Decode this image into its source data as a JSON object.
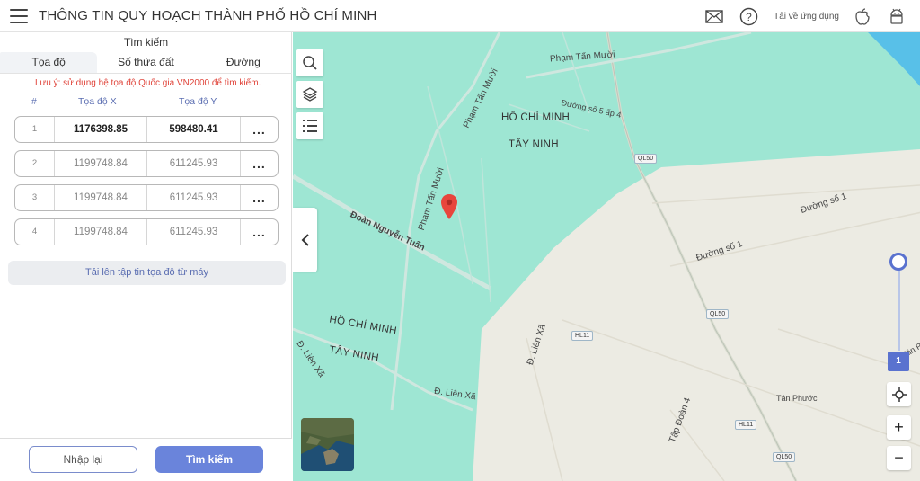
{
  "header": {
    "title": "THÔNG TIN QUY HOẠCH THÀNH PHỐ HỒ CHÍ MINH",
    "download_label": "Tải về ứng dụng",
    "icons": [
      "menu-icon",
      "mail-icon",
      "help-icon",
      "apple-icon",
      "android-icon"
    ]
  },
  "panel": {
    "title": "Tìm kiếm",
    "tabs": [
      {
        "label": "Tọa độ",
        "active": true
      },
      {
        "label": "Số thửa đất",
        "active": false
      },
      {
        "label": "Đường",
        "active": false
      }
    ],
    "note": "Lưu ý: sử dụng hệ tọa độ Quốc gia VN2000 để tìm kiếm.",
    "columns": {
      "num": "#",
      "x": "Tọa độ X",
      "y": "Tọa độ Y"
    },
    "rows": [
      {
        "num": "1",
        "x": "1176398.85",
        "y": "598480.41",
        "more": "..."
      },
      {
        "num": "2",
        "x": "1199748.84",
        "y": "611245.93",
        "more": "..."
      },
      {
        "num": "3",
        "x": "1199748.84",
        "y": "611245.93",
        "more": "..."
      },
      {
        "num": "4",
        "x": "1199748.84",
        "y": "611245.93",
        "more": "..."
      }
    ],
    "upload_label": "Tải lên tập tin tọa độ từ máy",
    "reset_label": "Nhập lại",
    "search_label": "Tìm kiếm"
  },
  "map": {
    "labels": {
      "pham_tan_muoi_1": "Phạm Tấn Mười",
      "pham_tan_muoi_2": "Phạm Tấn Mười",
      "pham_tan_muoi_3": "Phạm Tấn Mười",
      "duong_so5": "Đường số 5 ấp 4",
      "hcm_1": "HỒ CHÍ MINH",
      "tay_ninh_1": "TÂY NINH",
      "doan_nguyen_tuan": "Đoàn Nguyễn Tuấn",
      "hcm_2": "HỒ CHÍ MINH",
      "tay_ninh_2": "TÂY NINH",
      "lien_xa_1": "Đ. Liên Xã",
      "lien_xa_2": "Đ. Liên Xã",
      "lien_xa_3": "Đ. Liên Xã",
      "duong_so1_a": "Đường số 1",
      "duong_so1_b": "Đường số 1",
      "tap_doan4": "Tập Đoàn 4",
      "tan_phuoc": "Tân Phước",
      "tan_pho": "Tân Phư"
    },
    "shields": {
      "ql50_a": "QL50",
      "ql50_b": "QL50",
      "ql50_c": "QL50",
      "hl11_a": "HL11",
      "hl11_b": "HL11"
    },
    "zoom_level": "1",
    "zoom_in": "+",
    "zoom_out": "−",
    "colors": {
      "green_zone": "#9ee6d3",
      "beige_zone": "#ecebe3",
      "accent": "#5a72cf",
      "marker": "#e8453c"
    }
  }
}
